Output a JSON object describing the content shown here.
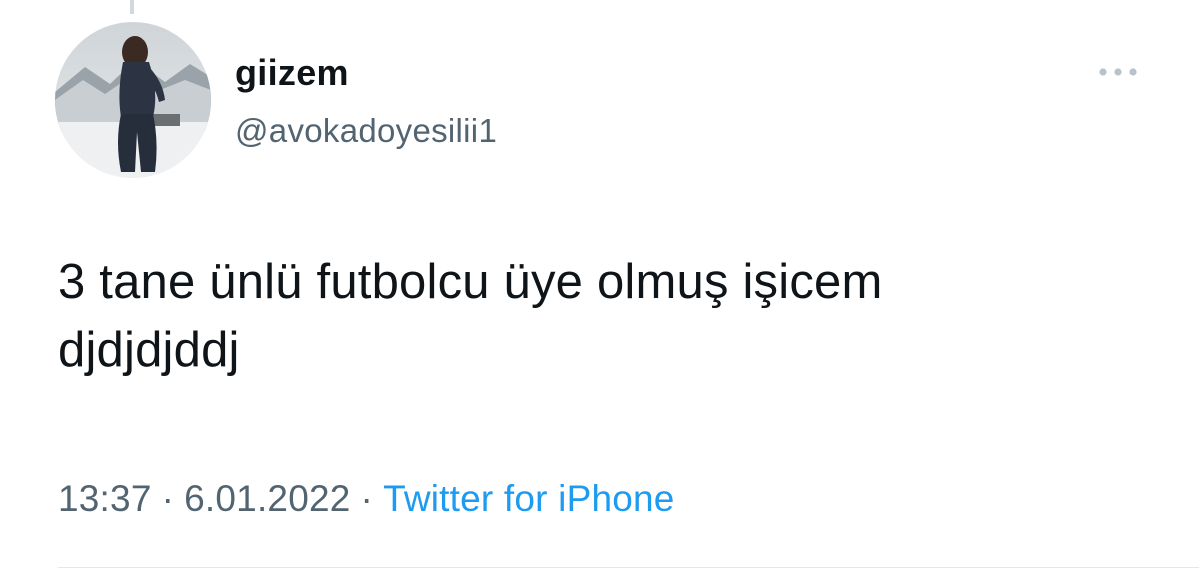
{
  "tweet": {
    "author": {
      "display_name": "giizem",
      "handle": "@avokadoyesilii1",
      "avatar_icon": "profile-photo"
    },
    "text": "3 tane ünlü futbolcu üye olmuş işicem\ndjdjdjddj",
    "time": "13:37",
    "separator": "·",
    "date": "6.01.2022",
    "source": "Twitter for iPhone",
    "more_icon": "more-horizontal-icon"
  },
  "colors": {
    "text_primary": "#0f1419",
    "text_secondary": "#536471",
    "link": "#1d9bf0",
    "more_icon": "#b9c2ca"
  }
}
